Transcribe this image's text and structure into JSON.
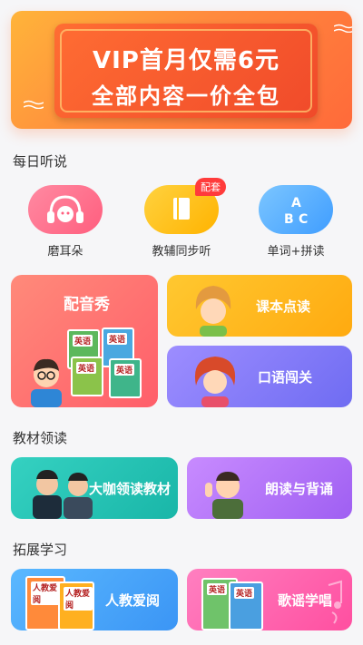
{
  "banner": {
    "line1": "VIP首月仅需6元",
    "line2": "全部内容一价全包"
  },
  "sections": {
    "daily": "每日听说",
    "textbook": "教材领读",
    "expand": "拓展学习"
  },
  "daily_items": [
    {
      "label": "磨耳朵",
      "icon": "headphones-icon",
      "color": "#ff6f8c"
    },
    {
      "label": "教辅同步听",
      "icon": "book-icon",
      "color": "#ffc21a",
      "badge": "配套"
    },
    {
      "label": "单词+拼读",
      "icon": "abc-icon",
      "color": "#5ab2ff"
    }
  ],
  "cards": {
    "dubbing": "配音秀",
    "textbook_reading": "课本点读",
    "oral": "口语闯关",
    "expert": "大咖领读教材",
    "recite": "朗读与背诵",
    "pep": "人教爱阅",
    "songs": "歌谣学唱"
  },
  "book_covers": {
    "english": "英语",
    "pep_cover": "人教爱阅"
  }
}
